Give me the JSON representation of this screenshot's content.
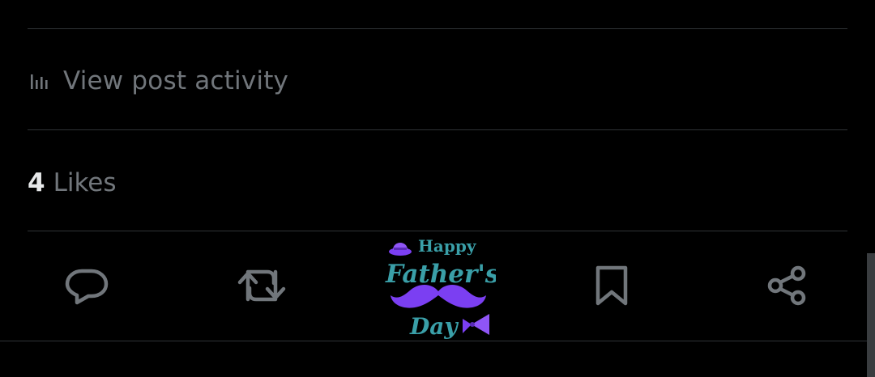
{
  "post_activity": {
    "label": "View post activity",
    "icon": "analytics-icon"
  },
  "likes": {
    "count": "4",
    "label": "Likes"
  },
  "actions": {
    "reply_icon": "reply-icon",
    "repost_icon": "repost-icon",
    "bookmark_icon": "bookmark-icon",
    "share_icon": "share-icon"
  },
  "sticker": {
    "line1": "Happy",
    "line2": "Father's",
    "line3": "Day"
  },
  "colors": {
    "background": "#000000",
    "divider": "#2f3336",
    "muted_text": "#71767b",
    "primary_text": "#e7e9ea",
    "sticker_teal": "#3a9fa8",
    "sticker_purple": "#7b3ff2"
  }
}
